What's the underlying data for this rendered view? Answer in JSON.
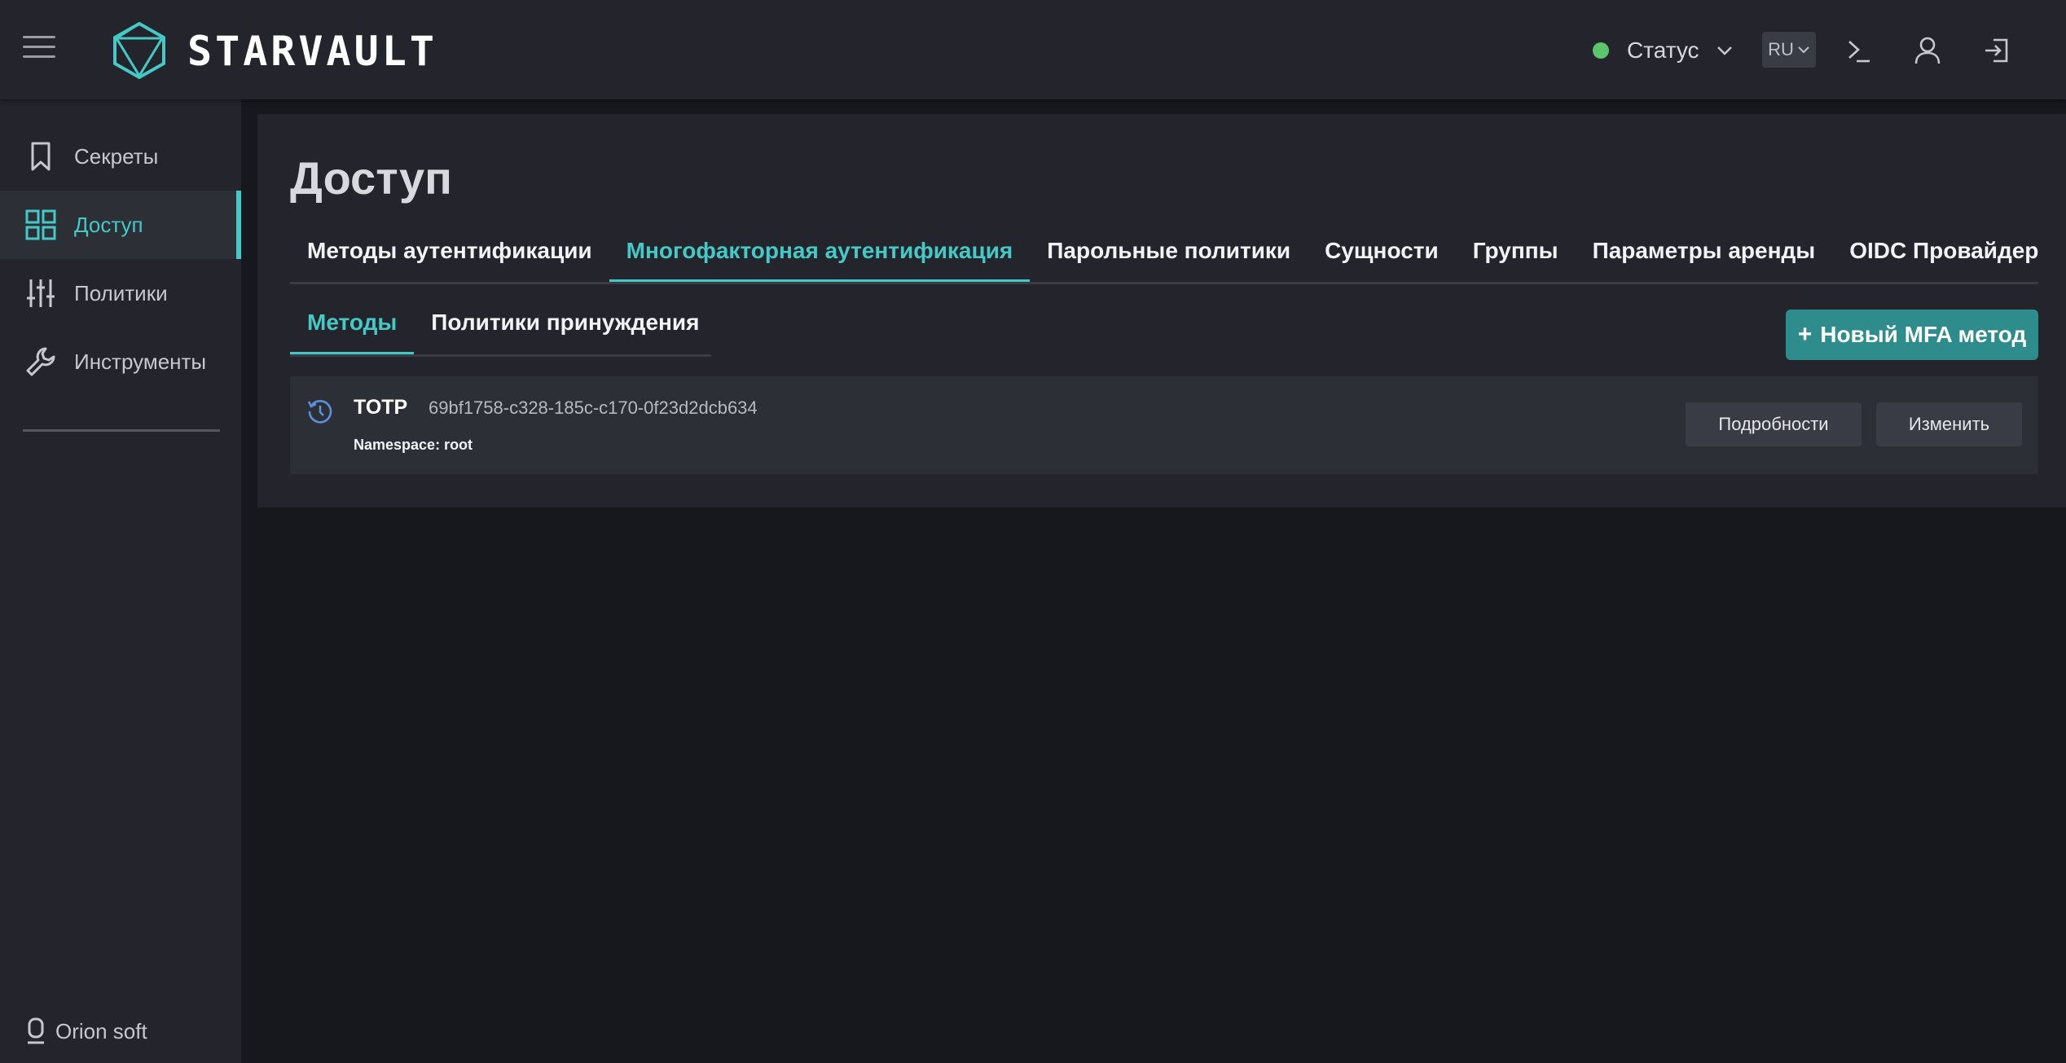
{
  "app": {
    "logo_text": "STARVAULT",
    "status_label": "Статус",
    "language": "RU"
  },
  "sidebar": {
    "items": [
      {
        "label": "Секреты",
        "icon": "bookmark-icon",
        "active": false
      },
      {
        "label": "Доступ",
        "icon": "grid-icon",
        "active": true
      },
      {
        "label": "Политики",
        "icon": "sliders-icon",
        "active": false
      },
      {
        "label": "Инструменты",
        "icon": "wrench-icon",
        "active": false
      }
    ],
    "footer": "Orion soft"
  },
  "main": {
    "title": "Доступ",
    "tabs": [
      {
        "label": "Методы аутентификации"
      },
      {
        "label": "Многофакторная аутентификация",
        "active": true
      },
      {
        "label": "Парольные политики"
      },
      {
        "label": "Сущности"
      },
      {
        "label": "Группы"
      },
      {
        "label": "Параметры аренды"
      },
      {
        "label": "OIDC Провайдер"
      }
    ],
    "subtabs": [
      {
        "label": "Методы",
        "active": true
      },
      {
        "label": "Политики принуждения"
      }
    ],
    "new_button": "Новый MFA метод",
    "mfa_methods": [
      {
        "type": "TOTP",
        "id": "69bf1758-c328-185c-c170-0f23d2dcb634",
        "namespace": "Namespace: root",
        "details_label": "Подробности",
        "edit_label": "Изменить"
      }
    ]
  },
  "colors": {
    "accent": "#46c9c6",
    "button_primary": "#2f8c8c",
    "status_ok": "#5cc46c",
    "surface": "#24252c",
    "background": "#17181d"
  }
}
